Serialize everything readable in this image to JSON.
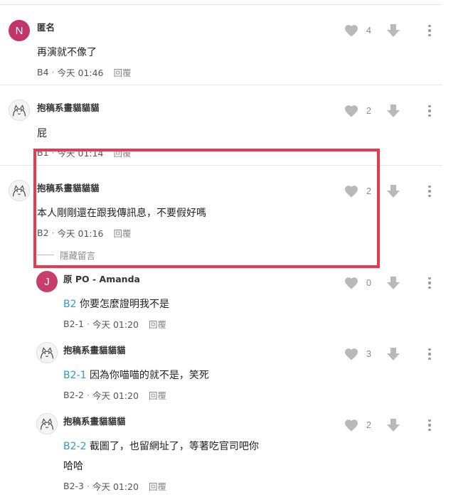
{
  "colors": {
    "highlight_border": "#e8394f",
    "reply_ref": "#3397cf",
    "avatar_n": "#c23569",
    "avatar_j": "#c63f6b",
    "icon_grey": "#b9b9b9"
  },
  "comments": [
    {
      "avatar_letter": "N",
      "author": "匿名",
      "body": "再演就不像了",
      "floor": "B4",
      "time": "今天 01:46",
      "reply_label": "回覆",
      "likes": "4"
    },
    {
      "author": "抱稿系畫貓貓貓",
      "body": "屁",
      "floor": "B1",
      "time": "今天 01:14",
      "reply_label": "回覆",
      "likes": "2"
    },
    {
      "author": "抱稿系畫貓貓貓",
      "body": "本人剛剛還在跟我傳訊息，不要假好嗎",
      "floor": "B2",
      "time": "今天 01:16",
      "reply_label": "回覆",
      "likes": "2",
      "hide_label": "隱藏留言"
    }
  ],
  "replies": [
    {
      "avatar_letter": "J",
      "author": "原 PO - Amanda",
      "reply_ref": "B2",
      "body": "你要怎麼證明我不是",
      "floor": "B2-1",
      "time": "今天 01:20",
      "reply_label": "回覆",
      "likes": "0"
    },
    {
      "author": "抱稿系畫貓貓貓",
      "reply_ref": "B2-1",
      "body": "因為你喵喵的就不是，笑死",
      "floor": "B2-2",
      "time": "今天 01:20",
      "reply_label": "回覆",
      "likes": "3"
    },
    {
      "author": "抱稿系畫貓貓貓",
      "reply_ref": "B2-2",
      "body": "截圖了，也留網址了，等著吃官司吧你",
      "body_line2": "哈哈",
      "floor": "B2-3",
      "time": "今天 01:20",
      "reply_label": "回覆",
      "likes": "2"
    }
  ]
}
